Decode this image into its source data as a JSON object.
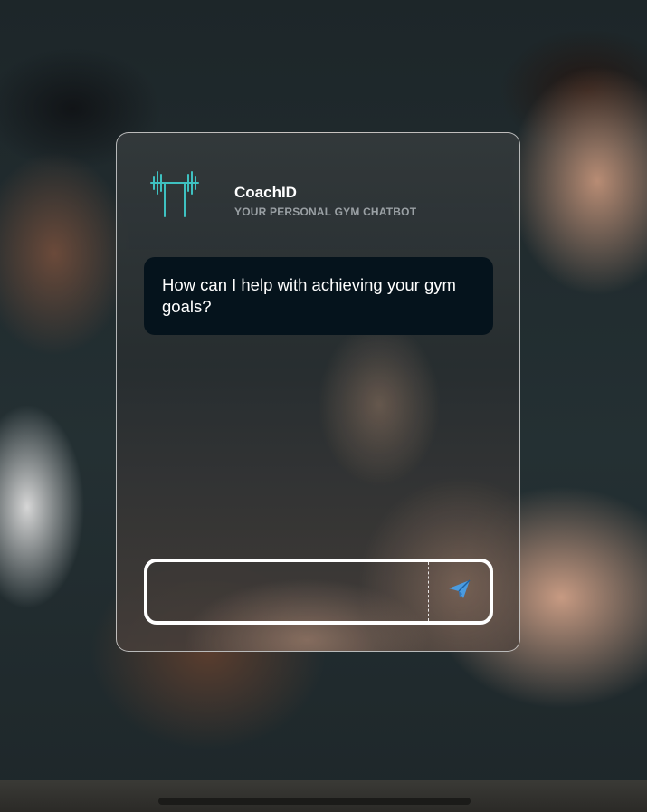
{
  "brand": {
    "name": "CoachID",
    "tagline": "YOUR PERSONAL GYM CHATBOT"
  },
  "chat": {
    "messages": [
      {
        "sender": "bot",
        "text": "How can I help with achieving your gym goals?"
      }
    ]
  },
  "composer": {
    "value": "",
    "placeholder": "",
    "send_icon": "send-icon"
  },
  "colors": {
    "accent": "#3ec1c1",
    "bubble_bg": "#05131c",
    "send_icon": "#4a9be0"
  }
}
